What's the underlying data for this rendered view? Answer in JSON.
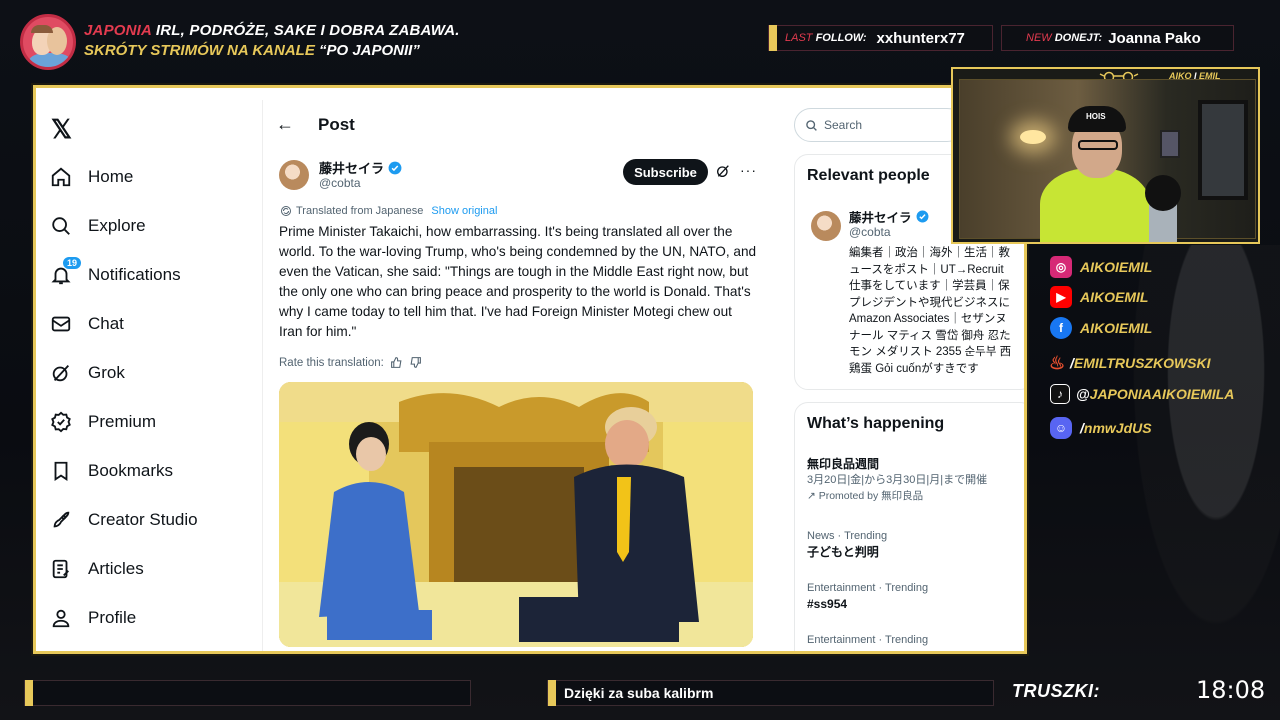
{
  "header": {
    "title_red": "JAPONIA",
    "title_rest": " IRL, PODRÓŻE, SAKE I DOBRA ZABAWA.",
    "subtitle_yellow": "SKRÓTY STRIMÓW NA KANALE ",
    "subtitle_white": "“PO JAPONII”"
  },
  "tickers": {
    "follow_prefix": "LAST ",
    "follow_label": "FOLLOW:",
    "follow_value": "xxhunterx77",
    "donate_prefix": "NEW ",
    "donate_label": "DONEJT:",
    "donate_value": "Joanna Pako"
  },
  "x": {
    "logo": "𝕏",
    "nav": [
      {
        "label": "Home",
        "icon": "home-icon"
      },
      {
        "label": "Explore",
        "icon": "search-icon"
      },
      {
        "label": "Notifications",
        "icon": "bell-icon",
        "badge": "19"
      },
      {
        "label": "Chat",
        "icon": "mail-icon"
      },
      {
        "label": "Grok",
        "icon": "grok-icon"
      },
      {
        "label": "Premium",
        "icon": "premium-icon"
      },
      {
        "label": "Bookmarks",
        "icon": "bookmark-icon"
      },
      {
        "label": "Creator Studio",
        "icon": "rocket-icon"
      },
      {
        "label": "Articles",
        "icon": "articles-icon"
      },
      {
        "label": "Profile",
        "icon": "person-icon"
      }
    ],
    "post": {
      "back": "←",
      "header": "Post",
      "author_name": "藤井セイラ",
      "author_handle": "@cobta",
      "subscribe_label": "Subscribe",
      "more": "···",
      "translated_label": "Translated from Japanese",
      "show_original": "Show original",
      "text": "Prime Minister Takaichi, how embarrassing. It's being translated all over the world. To the war-loving Trump, who's being condemned by the UN, NATO, and even the Vatican, she said: \"Things are tough in the Middle East right now, but the only one who can bring peace and prosperity to the world is Donald. That's why I came today to tell him that. I've had Foreign Minister Motegi chew out Iran for him.\"",
      "rate_label": "Rate this translation:"
    },
    "right": {
      "search_placeholder": "Search",
      "relevant_title": "Relevant people",
      "rp_name": "藤井セイラ",
      "rp_handle": "@cobta",
      "rp_bio": "編集者｜政治｜海外｜生活｜教\nュースをポスト｜UT→Recruit\n仕事をしています｜学芸員｜保\nプレジデントや現代ビジネスに\nAmazon Associates｜セザンヌ\nナール マティス 雪岱 御舟 忍た\nモン メダリスト 2355 순두부 西\n鶏蛋 Gỏi cuốnがすきです",
      "happening_title": "What’s happening",
      "trends": [
        {
          "meta": "",
          "title": "無印良品週間",
          "sub": "3月20日|金|から3月30日|月|まで開催",
          "promo": "Promoted by 無印良品"
        },
        {
          "meta": "News · Trending",
          "title": "子どもと判明",
          "sub": "",
          "promo": ""
        },
        {
          "meta": "Entertainment · Trending",
          "title": "#ss954",
          "sub": "",
          "promo": ""
        },
        {
          "meta": "Entertainment · Trending",
          "title": "",
          "sub": "",
          "promo": ""
        }
      ]
    }
  },
  "webcam": {
    "tag_left": "AIKO",
    "tag_amp": " I ",
    "tag_right": "EMIL",
    "cap_text": "HOIS"
  },
  "socials": [
    {
      "icon": "instagram-icon",
      "text": "AIKOIEMIL",
      "color": "#d62976"
    },
    {
      "icon": "youtube-icon",
      "text": "AIKOEMIL",
      "color": "#ff0000"
    },
    {
      "icon": "facebook-icon",
      "text": "AIKOIEMIL",
      "color": "#1877f2"
    },
    {
      "icon": "flame-icon",
      "slash": "/",
      "text": "EMILTRUSZKOWSKI",
      "color": "#e8502f"
    },
    {
      "icon": "tiktok-icon",
      "slash": "@",
      "text": "JAPONIAAIKOIEMILA",
      "color": "#111111"
    },
    {
      "icon": "discord-icon",
      "slash": "/",
      "text": "nmwJdUS",
      "color": "#5865f2"
    }
  ],
  "bottom": {
    "message": "Dzięki za suba kalibrm",
    "truszki": "TRUSZKI:",
    "clock": "18:08"
  },
  "colors": {
    "accent": "#e7c85a",
    "red": "#e33b4f",
    "x_blue": "#1d9bf0"
  }
}
